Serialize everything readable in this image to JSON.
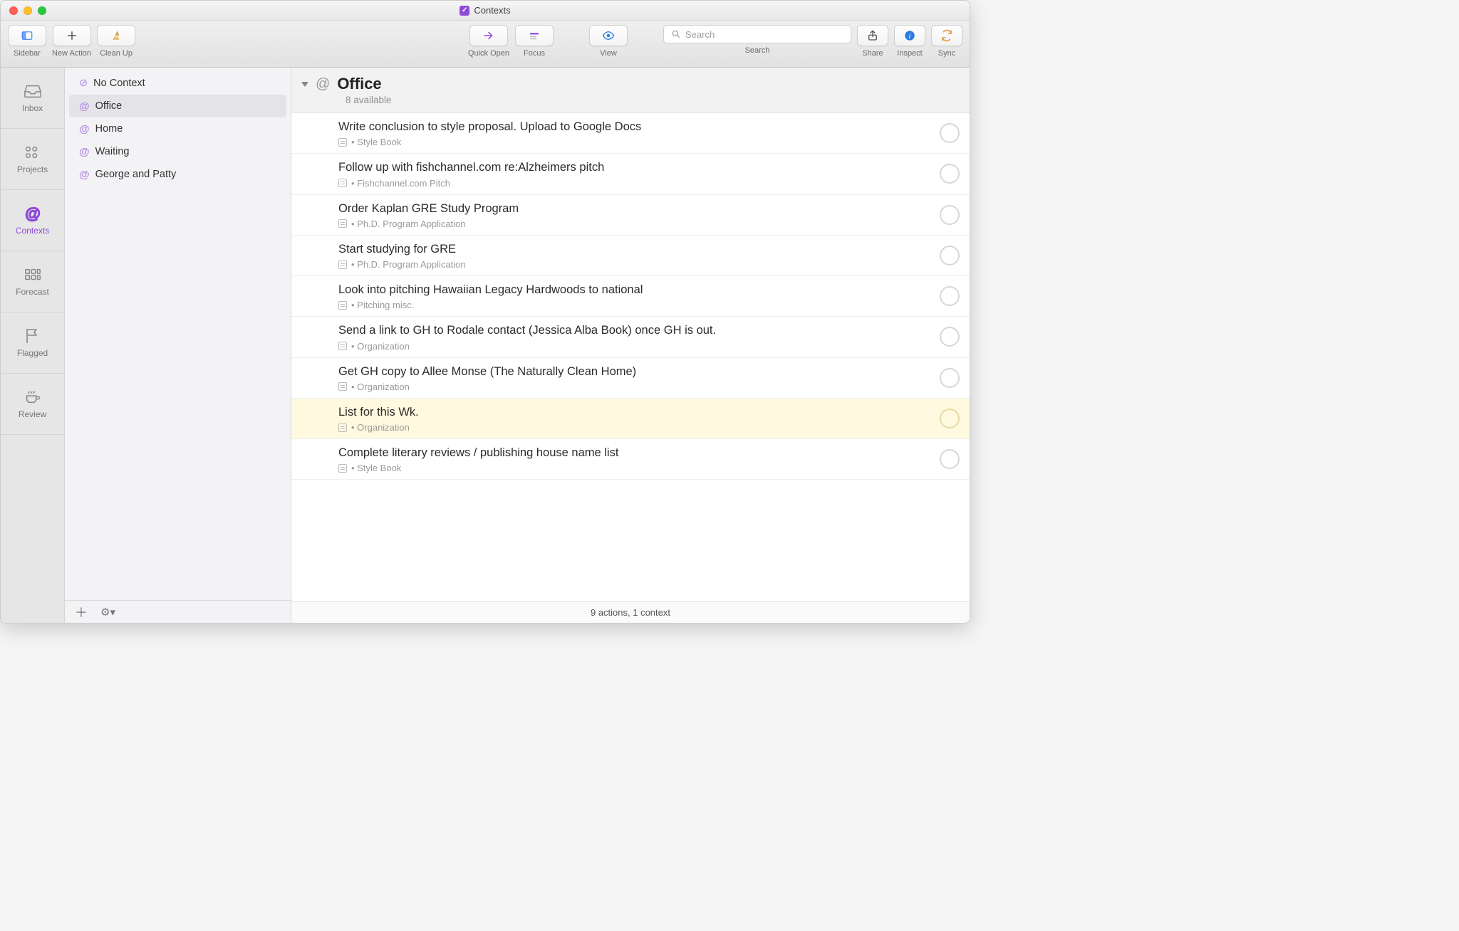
{
  "window": {
    "title": "Contexts"
  },
  "toolbar": {
    "sidebar": "Sidebar",
    "new_action": "New Action",
    "clean_up": "Clean Up",
    "quick_open": "Quick Open",
    "focus": "Focus",
    "view": "View",
    "search_label": "Search",
    "search_placeholder": "Search",
    "share": "Share",
    "inspect": "Inspect",
    "sync": "Sync"
  },
  "rail": {
    "items": [
      {
        "label": "Inbox"
      },
      {
        "label": "Projects"
      },
      {
        "label": "Contexts"
      },
      {
        "label": "Forecast"
      },
      {
        "label": "Flagged"
      },
      {
        "label": "Review"
      }
    ],
    "active_index": 2
  },
  "contexts": {
    "items": [
      {
        "label": "No Context",
        "kind": "none"
      },
      {
        "label": "Office",
        "kind": "at"
      },
      {
        "label": "Home",
        "kind": "at"
      },
      {
        "label": "Waiting",
        "kind": "at"
      },
      {
        "label": "George and Patty",
        "kind": "at"
      }
    ],
    "selected_index": 1
  },
  "header": {
    "title": "Office",
    "subtitle": "8 available"
  },
  "tasks": [
    {
      "title": "Write conclusion to style proposal. Upload to Google Docs",
      "project": "Style Book",
      "highlight": false
    },
    {
      "title": "Follow up with fishchannel.com re:Alzheimers pitch",
      "project": "Fishchannel.com Pitch",
      "highlight": false
    },
    {
      "title": "Order Kaplan GRE Study Program",
      "project": "Ph.D. Program Application",
      "highlight": false
    },
    {
      "title": "Start studying for GRE",
      "project": "Ph.D. Program Application",
      "highlight": false
    },
    {
      "title": "Look into pitching Hawaiian Legacy Hardwoods to national",
      "project": "Pitching misc.",
      "highlight": false
    },
    {
      "title": "Send a link to GH to Rodale contact (Jessica Alba Book) once GH is out.",
      "project": "Organization",
      "highlight": false
    },
    {
      "title": "Get GH copy to Allee Monse (The Naturally Clean Home)",
      "project": "Organization",
      "highlight": false
    },
    {
      "title": "List for this Wk.",
      "project": "Organization",
      "highlight": true
    },
    {
      "title": "Complete literary reviews / publishing house name list",
      "project": "Style Book",
      "highlight": false
    }
  ],
  "statusbar": {
    "text": "9 actions, 1 context"
  }
}
